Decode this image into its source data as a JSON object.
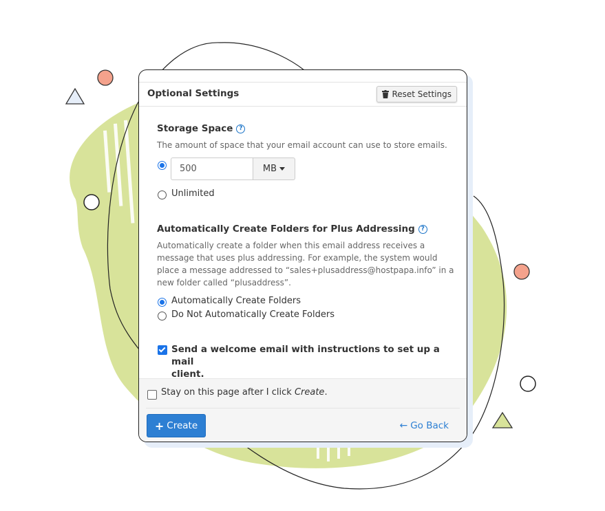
{
  "header": {
    "title": "Optional Settings",
    "reset_label": "Reset Settings"
  },
  "storage": {
    "title": "Storage Space",
    "help": "?",
    "description": "The amount of space that your email account can use to store emails.",
    "quota_value": "500",
    "unit": "MB",
    "unlimited_label": "Unlimited",
    "selected": "custom"
  },
  "folders": {
    "title": "Automatically Create Folders for Plus Addressing",
    "help": "?",
    "description_lines": [
      "Automatically create a folder when this email address receives a",
      "message that uses plus addressing. For example, the system would",
      "place a message addressed to “sales+plusaddress@hostpapa.info” in a",
      "new folder called “plusaddress”."
    ],
    "option_auto": "Automatically Create Folders",
    "option_no_auto": "Do Not Automatically Create Folders",
    "selected": "auto"
  },
  "welcome": {
    "label_line1": "Send a welcome email with instructions to set up a mail",
    "label_line2": "client.",
    "checked": true
  },
  "footer": {
    "stay_prefix": "Stay on this page after I click ",
    "stay_emph": "Create",
    "stay_suffix": ".",
    "stay_checked": false,
    "create_label": "Create",
    "go_back_label": "Go Back"
  },
  "colors": {
    "accent": "#2d7fd3",
    "blob_green": "#d8e39a",
    "circle_coral": "#f4a28c"
  },
  "icons": {
    "reset": "trash-icon",
    "help": "question-circle-icon",
    "unit_dropdown": "caret-down-icon",
    "create": "plus-icon",
    "go_back": "arrow-left-icon"
  }
}
